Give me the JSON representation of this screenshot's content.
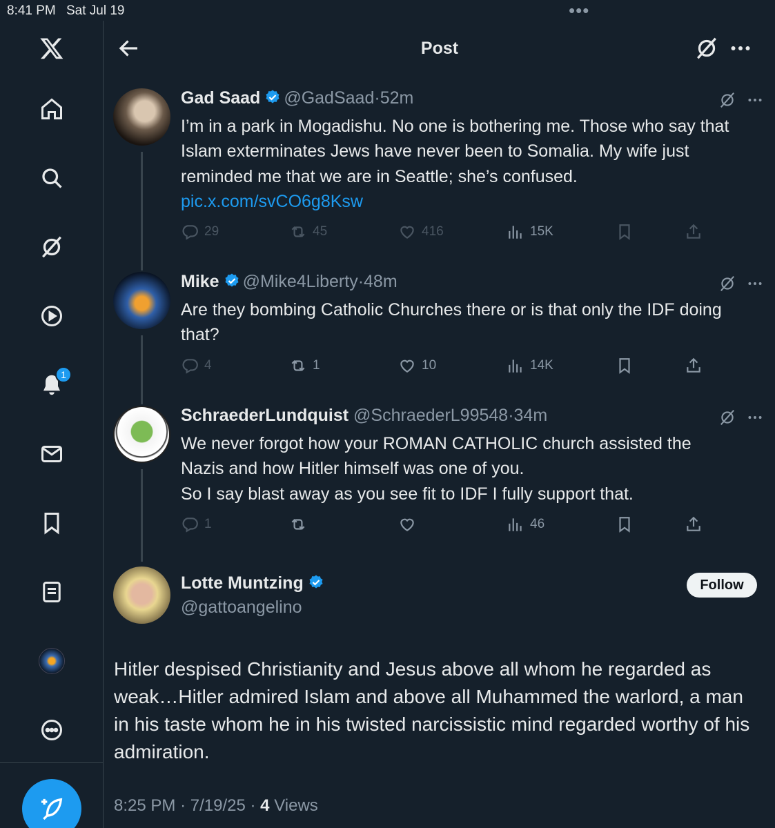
{
  "status_bar": {
    "time": "8:41 PM",
    "date": "Sat Jul 19",
    "dots": "•••"
  },
  "sidebar": {
    "items": [
      {
        "icon": "x-logo-icon"
      },
      {
        "icon": "home-icon"
      },
      {
        "icon": "search-icon"
      },
      {
        "icon": "grok-icon"
      },
      {
        "icon": "video-icon"
      },
      {
        "icon": "notifications-icon",
        "badge": "1"
      },
      {
        "icon": "messages-icon"
      },
      {
        "icon": "bookmarks-icon"
      },
      {
        "icon": "lists-icon"
      },
      {
        "icon": "profile-avatar"
      },
      {
        "icon": "more-icon"
      }
    ],
    "compose_icon": "compose-icon"
  },
  "header": {
    "title": "Post"
  },
  "thread": [
    {
      "name": "Gad Saad",
      "handle": "@GadSaad",
      "time": "52m",
      "text_before": "I’m in a park in Mogadishu. No one is bothering me. Those who say that Islam exterminates Jews have never been to Somalia. My wife just reminded me that we are in Seattle; she’s confused. ",
      "link": "pic.x.com/svCO6g8Ksw",
      "replies": "29",
      "reposts": "45",
      "likes": "416",
      "views": "15K"
    },
    {
      "name": "Mike",
      "handle": "@Mike4Liberty",
      "time": "48m",
      "text": "Are they bombing Catholic Churches there or is that only the IDF doing that?",
      "replies": "4",
      "reposts": "1",
      "likes": "10",
      "views": "14K"
    },
    {
      "name": "SchraederLundquist",
      "handle": "@SchraederL99548",
      "time": "34m",
      "lines": [
        "We never forgot how your ROMAN CATHOLIC church assisted the",
        "Nazis and how Hitler himself was one of you.",
        "So I say blast away as you see fit to IDF I fully support that."
      ],
      "replies": "1",
      "reposts": "",
      "likes": "",
      "views": "46"
    }
  ],
  "main_post": {
    "name": "Lotte Muntzing",
    "handle": "@gattoangelino",
    "follow_label": "Follow",
    "text": "Hitler despised Christianity and Jesus above all whom he regarded as weak…Hitler admired Islam and above all Muhammed the warlord,  a man in his taste whom he in his twisted narcissistic mind regarded worthy of his admiration.",
    "time": "8:25 PM",
    "date": "7/19/25",
    "views_count": "4",
    "views_label": "Views"
  },
  "colors": {
    "background": "#15202b",
    "accent": "#1d9bf0",
    "muted": "#8b98a5",
    "text": "#e7e9ea"
  },
  "separator": "·"
}
